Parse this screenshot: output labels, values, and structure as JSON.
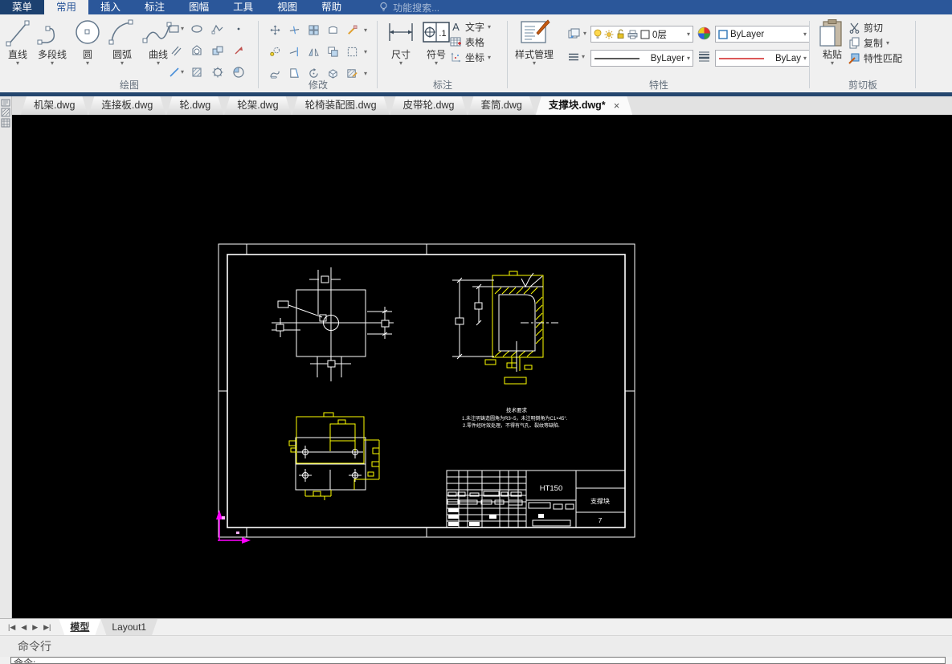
{
  "colors": {
    "accent": "#2b579a",
    "menu_dark": "#1c4170",
    "canvas": "#000000",
    "selection": "#ffff00",
    "ucs": "#ff00ff",
    "drawing_white": "#ffffff"
  },
  "menu": {
    "items": [
      "菜单",
      "常用",
      "插入",
      "标注",
      "图幅",
      "工具",
      "视图",
      "帮助"
    ],
    "active": "常用",
    "search_placeholder": "功能搜索..."
  },
  "ribbon": {
    "draw": {
      "label": "绘图",
      "buttons": [
        "直线",
        "多段线",
        "圆",
        "圆弧",
        "曲线"
      ]
    },
    "modify": {
      "label": "修改"
    },
    "annotate": {
      "label": "标注",
      "dim": "尺寸",
      "symbol": "符号",
      "text": "文字",
      "table": "表格",
      "coord": "坐标",
      "text_icon_glyph": "A",
      "datum_icon_glyph": ".1"
    },
    "properties": {
      "label": "特性",
      "style_manager": "样式管理",
      "layer_value": "0层",
      "color_value": "ByLayer",
      "linetype_value": "ByLayer",
      "lineweight_value": "ByLay"
    },
    "clipboard": {
      "label": "剪切板",
      "paste": "粘贴",
      "cut": "剪切",
      "copy": "复制",
      "match": "特性匹配"
    }
  },
  "doc_tabs": {
    "tabs": [
      "机架.dwg",
      "连接板.dwg",
      "轮.dwg",
      "轮架.dwg",
      "轮椅装配图.dwg",
      "皮带轮.dwg",
      "套筒.dwg",
      "支撑块.dwg*"
    ],
    "active": "支撑块.dwg*",
    "close_glyph": "×"
  },
  "drawing": {
    "material": "HT150",
    "part_name": "支撑块",
    "sheet_no": "7",
    "tech_title": "技术要求",
    "tech_line1": "1.未注明铸造圆角为R3~5，未注明倒角为C1×45°.",
    "tech_line2": "2.零件经时效处理，不得有气孔、裂纹等缺陷."
  },
  "layout_bar": {
    "nav": [
      "|◀",
      "◀",
      "▶",
      "▶|"
    ],
    "model_tab": "模型",
    "layout_tab": "Layout1"
  },
  "command": {
    "panel_title": "命令行",
    "prompt": "命令:"
  },
  "glyphs": {
    "caret": "▾"
  }
}
